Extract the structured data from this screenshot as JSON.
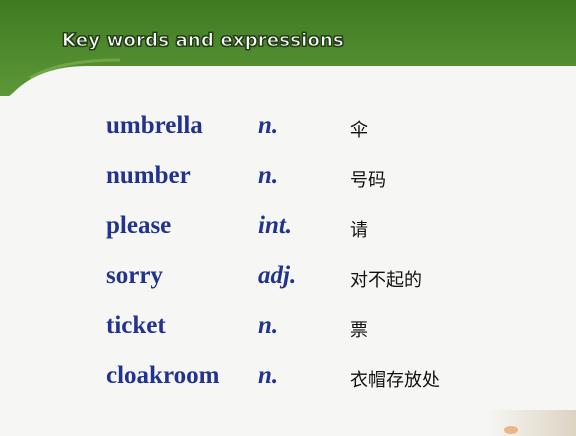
{
  "header": {
    "title": "Key words and expressions"
  },
  "vocabulary": [
    {
      "word": "umbrella",
      "pos": "n.",
      "meaning": "伞"
    },
    {
      "word": "number",
      "pos": "n.",
      "meaning": "号码"
    },
    {
      "word": "please",
      "pos": "int.",
      "meaning": "请"
    },
    {
      "word": "sorry",
      "pos": "adj.",
      "meaning": "对不起的"
    },
    {
      "word": "ticket",
      "pos": "n.",
      "meaning": "票"
    },
    {
      "word": "cloakroom",
      "pos": "n.",
      "meaning": "衣帽存放处"
    }
  ],
  "colors": {
    "banner_green": "#4e8a2e",
    "banner_dark": "#2f6418",
    "word_blue": "#22338f"
  }
}
